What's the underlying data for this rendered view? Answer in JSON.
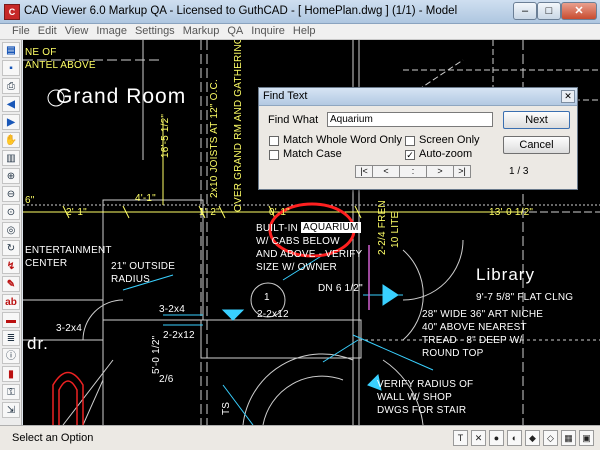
{
  "window": {
    "title": "CAD Viewer 6.0 Markup QA  -  Licensed to GuthCAD  -  [ HomePlan.dwg ] (1/1)  -  Model",
    "app_icon": "cad-viewer-logo",
    "minimize": "–",
    "maximize": "□",
    "close": "✕"
  },
  "menu": [
    "File",
    "Edit",
    "View",
    "Image",
    "Settings",
    "Markup",
    "QA",
    "Inquire",
    "Help"
  ],
  "left_toolbar": [
    "open-icon",
    "save-icon",
    "print-icon",
    "back-icon",
    "forward-icon",
    "hand-icon",
    "print-preview-icon",
    "zoom-in-icon",
    "zoom-out-icon",
    "zoom-window-icon",
    "zoom-extents-icon",
    "rotate-icon",
    "measure-icon",
    "pen-icon",
    "text-icon",
    "highlight-icon",
    "layers-icon",
    "info-icon",
    "book-icon",
    "key-icon",
    "export-icon"
  ],
  "drawing": {
    "texts": {
      "ne_of": "NE OF",
      "antel_above": "ANTEL ABOVE",
      "grand_room": "Grand Room",
      "joists": "2x10 JOISTS AT 12\" O.C.",
      "over_grand": "OVER GRAND RM AND GATHERING",
      "dim_16_5": "16'-5 1/2\"",
      "dim_4_1": "4'-1\"",
      "dim_2_1": "2'-1\"",
      "dim_1_2": "1'-2\"",
      "dim_0_1": "0'-1\"",
      "dim_13_0": "13'-0 1/2\"",
      "dim_6": "6\"",
      "built_in": "BUILT-IN",
      "aquarium": "AQUARIUM",
      "cabs_below": "W/ CABS BELOW",
      "and_above": "AND ABOVE - VERIFY",
      "size_w_owner": "SIZE W/ OWNER",
      "entertainment": "ENTERTAINMENT",
      "center": "CENTER",
      "outside_1": "21\" OUTSIDE",
      "outside_2": "RADIUS",
      "library": "Library",
      "flat_clng": "9'-7 5/8\" FLAT CLNG",
      "dn_6": "DN 6 1/2\"",
      "tag_1": "1",
      "niche_1": "28\" WIDE 36\" ART NICHE",
      "niche_2": "40\" ABOVE NEAREST",
      "niche_3": "TREAD - 8\" DEEP W/",
      "niche_4": "ROUND TOP",
      "beam_32x4": "3-2x4",
      "beam_32x4b": "3-2x4",
      "beam_22x12": "2-2x12",
      "beam_22x12b": "2-2x12",
      "dim_5_0": "5'-0 1/2\"",
      "dim_2_6": "2/6",
      "dr": "dr.",
      "verify_1": "VERIFY RADIUS OF",
      "verify_2": "WALL W/ SHOP",
      "verify_3": "DWGS FOR STAIR",
      "fren": "2-2/4 FREN",
      "lite": "10 LITE",
      "ts": "TS"
    }
  },
  "find_dialog": {
    "title": "Find Text",
    "close": "✕",
    "find_what_label": "Find What",
    "find_what_value": "Aquarium",
    "next_label": "Next",
    "cancel_label": "Cancel",
    "options": [
      {
        "label": "Match Whole Word Only",
        "checked": false
      },
      {
        "label": "Match Case",
        "checked": false
      },
      {
        "label": "Screen Only",
        "checked": false
      },
      {
        "label": "Auto-zoom",
        "checked": true
      }
    ],
    "nav": [
      "|<",
      "<",
      ":",
      ">",
      ">|"
    ],
    "count": "1 / 3"
  },
  "status": {
    "text": "Select an Option",
    "tools": [
      "T",
      "✕",
      "●",
      "◐",
      "◆",
      "◇",
      "▦",
      "▣"
    ]
  }
}
